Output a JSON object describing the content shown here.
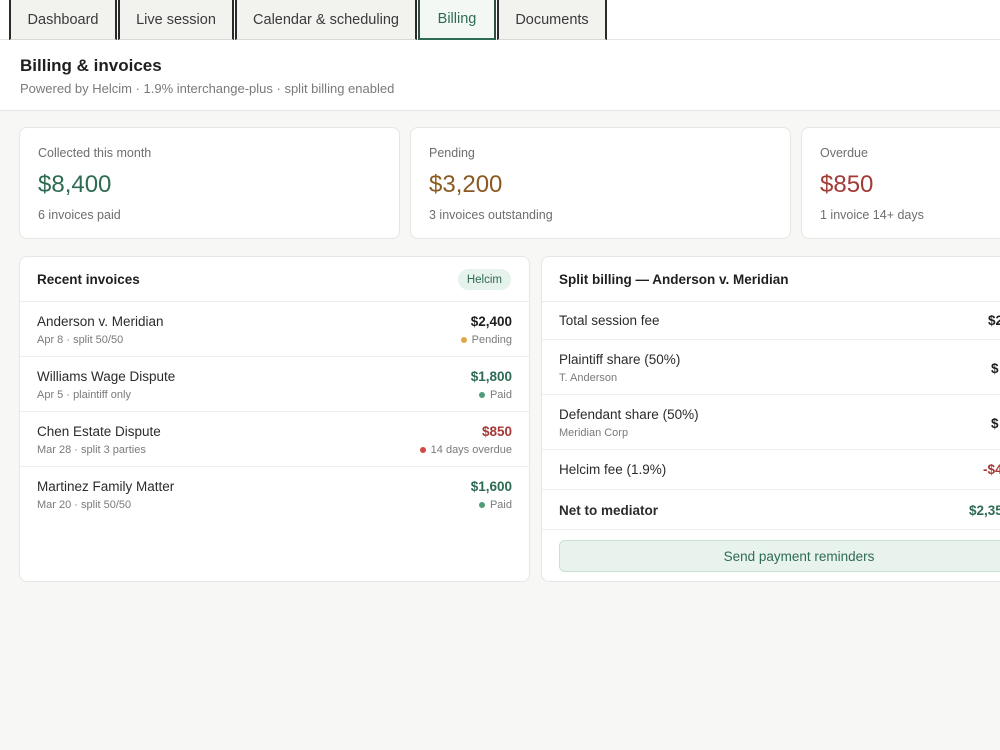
{
  "tabs": [
    {
      "label": "Dashboard"
    },
    {
      "label": "Live session"
    },
    {
      "label": "Calendar & scheduling"
    },
    {
      "label": "Billing"
    },
    {
      "label": "Documents"
    }
  ],
  "header": {
    "title": "Billing & invoices",
    "subtitle": "Powered by Helcim · 1.9% interchange-plus · split billing enabled"
  },
  "stats": [
    {
      "label": "Collected this month",
      "value": "$8,400",
      "sub": "6 invoices paid",
      "color": "#2e6b53"
    },
    {
      "label": "Pending",
      "value": "$3,200",
      "sub": "3 invoices outstanding",
      "color": "#8a5a22"
    },
    {
      "label": "Overdue",
      "value": "$850",
      "sub": "1 invoice 14+ days",
      "color": "#a33a36"
    }
  ],
  "invoices": {
    "title": "Recent invoices",
    "badge": "Helcim",
    "rows": [
      {
        "name": "Anderson v. Meridian",
        "meta": "Apr 8 · split 50/50",
        "amount": "$2,400",
        "status": "Pending"
      },
      {
        "name": "Williams Wage Dispute",
        "meta": "Apr 5 · plaintiff only",
        "amount": "$1,800",
        "status": "Paid"
      },
      {
        "name": "Chen Estate Dispute",
        "meta": "Mar 28 · split 3 parties",
        "amount": "$850",
        "status": "14 days overdue"
      },
      {
        "name": "Martinez Family Matter",
        "meta": "Mar 20 · split 50/50",
        "amount": "$1,600",
        "status": "Paid"
      }
    ]
  },
  "split": {
    "title": "Split billing — Anderson v. Meridian",
    "rows": [
      {
        "label": "Total session fee",
        "sub": "",
        "value": "$2"
      },
      {
        "label": "Plaintiff share (50%)",
        "sub": "T. Anderson",
        "value": "$"
      },
      {
        "label": "Defendant share (50%)",
        "sub": "Meridian Corp",
        "value": "$"
      },
      {
        "label": "Helcim fee (1.9%)",
        "sub": "",
        "value": "-$4"
      },
      {
        "label": "Net to mediator",
        "sub": "",
        "value": "$2,35"
      }
    ],
    "button": "Send payment reminders"
  },
  "colors": {
    "green": "#2e6b53",
    "amber": "#8a5a22",
    "red": "#a33a36",
    "dot_pending": "#e0a84a",
    "dot_paid": "#4f9a78",
    "dot_overdue": "#cf4a43"
  }
}
